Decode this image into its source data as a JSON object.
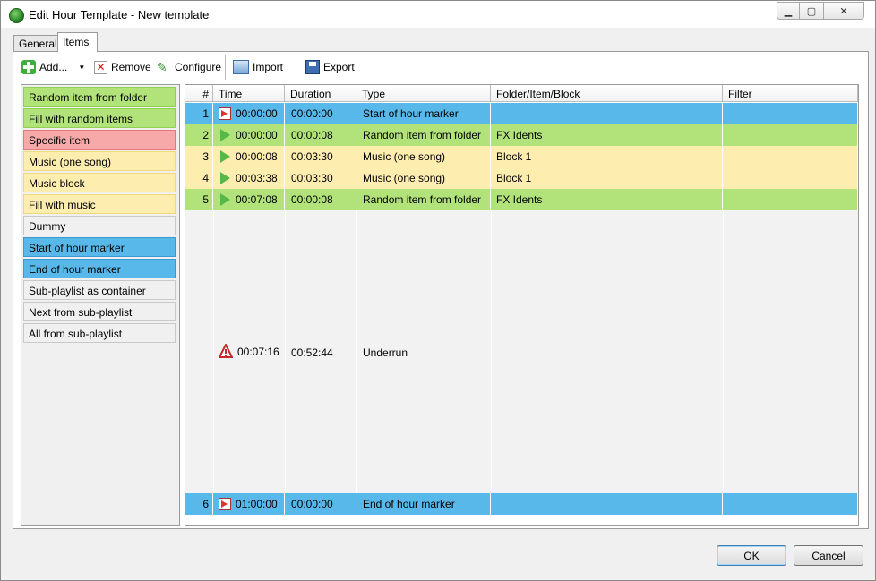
{
  "window": {
    "title": "Edit Hour Template - New template",
    "controls": [
      "minimize",
      "maximize",
      "close"
    ]
  },
  "tabs": [
    {
      "label": "General",
      "active": false
    },
    {
      "label": "Items",
      "active": true
    }
  ],
  "toolbar": {
    "add_label": "Add...",
    "remove_label": "Remove",
    "configure_label": "Configure",
    "import_label": "Import",
    "export_label": "Export"
  },
  "palette": [
    {
      "label": "Random item from folder",
      "kind": "green"
    },
    {
      "label": "Fill with random items",
      "kind": "green"
    },
    {
      "label": "Specific item",
      "kind": "red"
    },
    {
      "label": "Music (one song)",
      "kind": "yellow"
    },
    {
      "label": "Music block",
      "kind": "yellow"
    },
    {
      "label": "Fill with music",
      "kind": "yellow"
    },
    {
      "label": "Dummy",
      "kind": "grey"
    },
    {
      "label": "Start of hour marker",
      "kind": "blue"
    },
    {
      "label": "End of hour marker",
      "kind": "blue"
    },
    {
      "label": "Sub-playlist as container",
      "kind": "plain"
    },
    {
      "label": "Next from sub-playlist",
      "kind": "plain"
    },
    {
      "label": "All from sub-playlist",
      "kind": "plain"
    }
  ],
  "grid": {
    "columns": [
      "#",
      "Time",
      "Duration",
      "Type",
      "Folder/Item/Block",
      "Filter"
    ],
    "rows": [
      {
        "num": "1",
        "icon": "marker-icon",
        "time": "00:00:00",
        "duration": "00:00:00",
        "type": "Start of hour marker",
        "folder": "",
        "filter": "",
        "kind": "blue"
      },
      {
        "num": "2",
        "icon": "play-icon",
        "time": "00:00:00",
        "duration": "00:00:08",
        "type": "Random item from folder",
        "folder": "FX Idents",
        "filter": "",
        "kind": "green"
      },
      {
        "num": "3",
        "icon": "play-icon",
        "time": "00:00:08",
        "duration": "00:03:30",
        "type": "Music (one song)",
        "folder": "Block 1",
        "filter": "",
        "kind": "yellow"
      },
      {
        "num": "4",
        "icon": "play-icon",
        "time": "00:03:38",
        "duration": "00:03:30",
        "type": "Music (one song)",
        "folder": "Block 1",
        "filter": "",
        "kind": "yellow"
      },
      {
        "num": "5",
        "icon": "play-icon",
        "time": "00:07:08",
        "duration": "00:00:08",
        "type": "Random item from folder",
        "folder": "FX Idents",
        "filter": "",
        "kind": "green"
      }
    ],
    "underrun": {
      "icon": "warning-icon",
      "time": "00:07:16",
      "duration": "00:52:44",
      "type": "Underrun"
    },
    "end_row": {
      "num": "6",
      "icon": "marker-icon",
      "time": "01:00:00",
      "duration": "00:00:00",
      "type": "End of hour marker",
      "folder": "",
      "filter": "",
      "kind": "blue"
    }
  },
  "buttons": {
    "ok": "OK",
    "cancel": "Cancel"
  },
  "colors": {
    "green_bg": "#b2e37a",
    "green_border": "#8fcf52",
    "red_bg": "#f7a9a9",
    "red_border": "#e07a7a",
    "yellow_bg": "#fdeeb0",
    "yellow_border": "#f1d97a",
    "blue_bg": "#58b8ea",
    "blue_border": "#3a9ad0",
    "grey_bg": "#f0f0f0",
    "grey_border": "#c9c9c9"
  }
}
